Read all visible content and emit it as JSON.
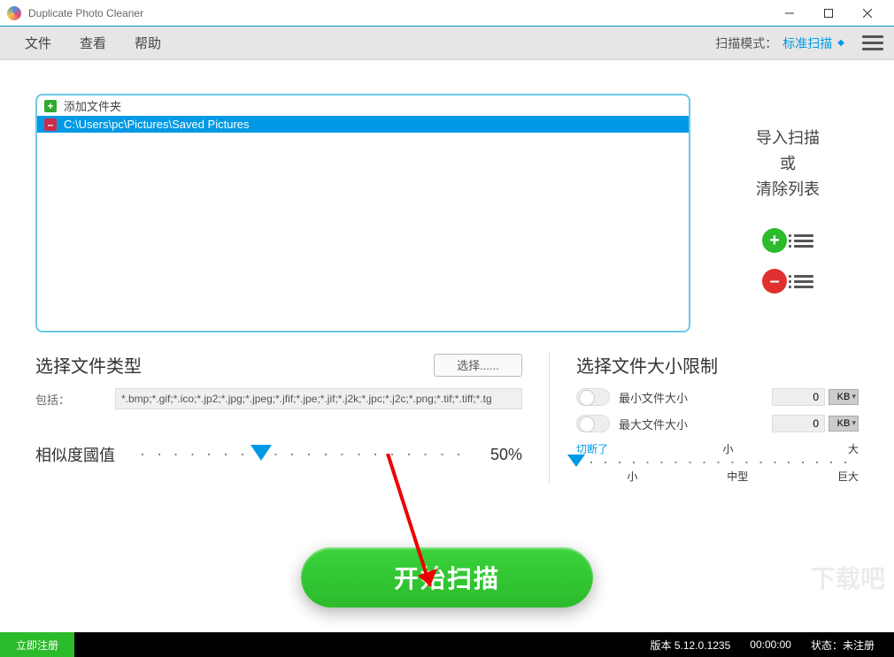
{
  "titlebar": {
    "title": "Duplicate Photo Cleaner"
  },
  "menu": {
    "file": "文件",
    "view": "查看",
    "help": "帮助",
    "scanmode_label": "扫描模式：",
    "scanmode_value": "标准扫描"
  },
  "folders": {
    "add_label": "添加文件夹",
    "path": "C:\\Users\\pc\\Pictures\\Saved Pictures"
  },
  "sidebtns": {
    "line1": "导入扫描",
    "line2": "或",
    "line3": "清除列表"
  },
  "filetypes": {
    "title": "选择文件类型",
    "select_btn": "选择......",
    "include_label": "包括：",
    "include_value": "*.bmp;*.gif;*.ico;*.jp2;*.jpg;*.jpeg;*.jfif;*.jpe;*.jif;*.j2k;*.jpc;*.j2c;*.png;*.tif;*.tiff;*.tg"
  },
  "threshold": {
    "label": "相似度國值",
    "value": "50%",
    "percent": 50
  },
  "sizelimit": {
    "title": "选择文件大小限制",
    "min_label": "最小文件大小",
    "min_value": "0",
    "min_unit": "KB",
    "max_label": "最大文件大小",
    "max_value": "0",
    "max_unit": "KB",
    "cutoff": "切断了",
    "top_mid": "小",
    "top_right": "大",
    "bot_left": "小",
    "bot_mid": "中型",
    "bot_right": "巨大"
  },
  "start": {
    "label": "开始扫描"
  },
  "status": {
    "register": "立即注册",
    "version": "版本 5.12.0.1235",
    "time": "00:00:00",
    "state": "状态：未注册"
  }
}
